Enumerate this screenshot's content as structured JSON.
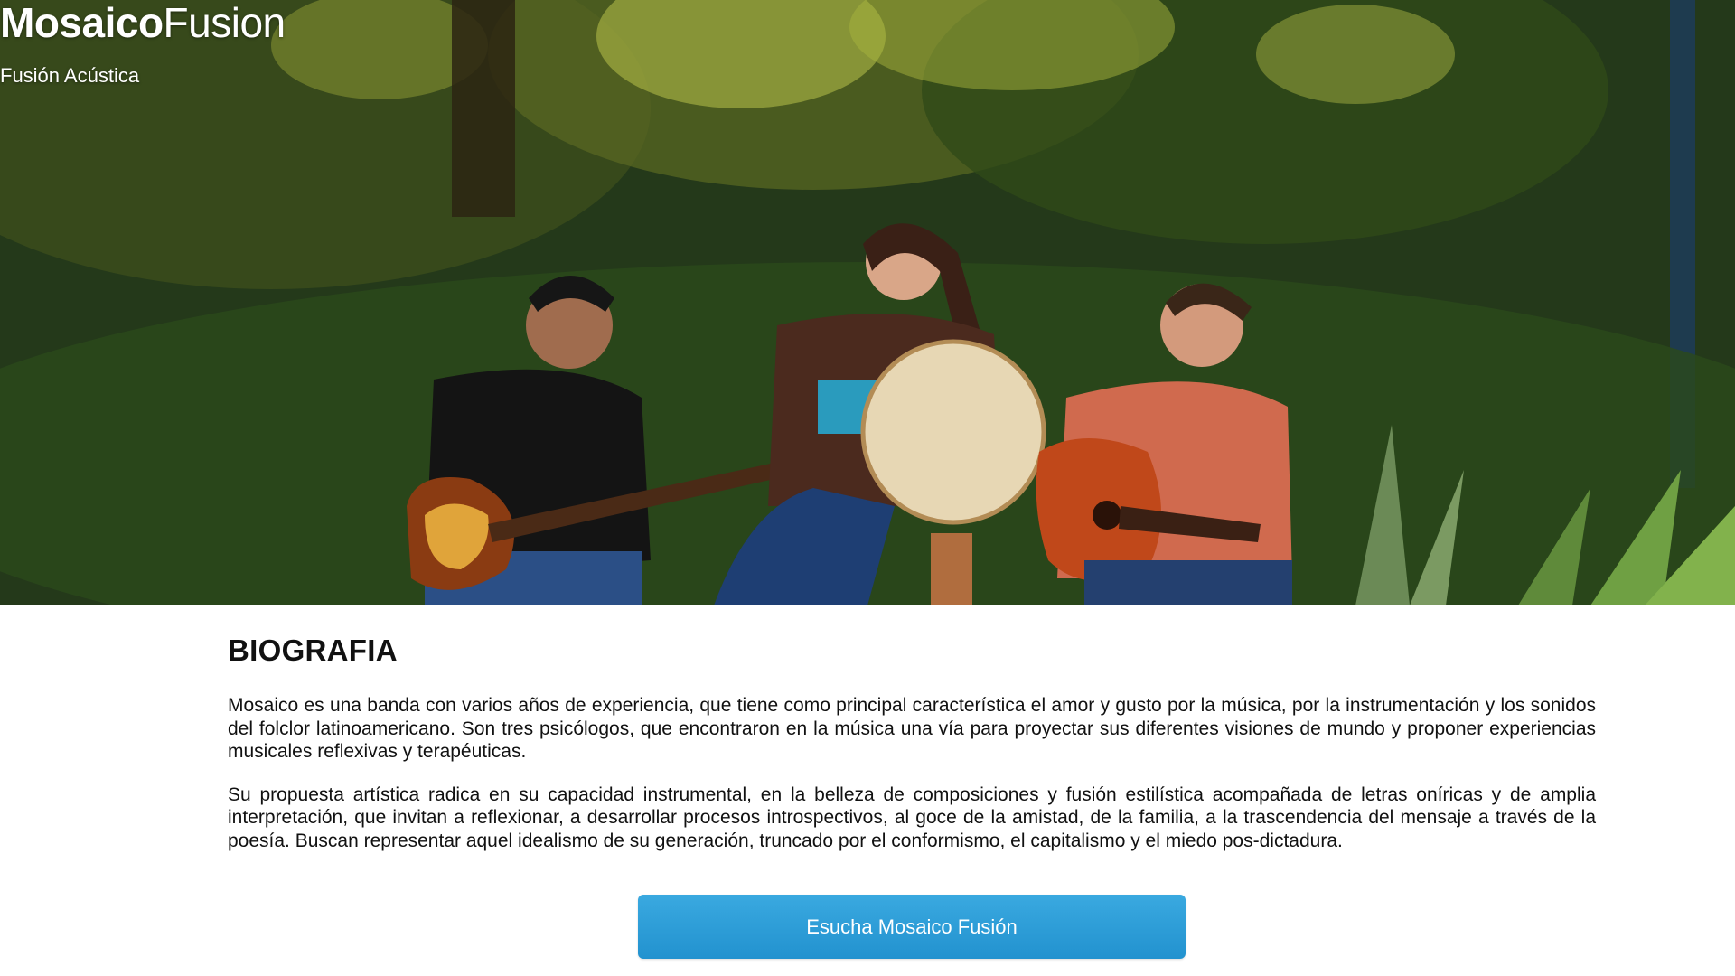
{
  "brand": {
    "title_bold": "Mosaico",
    "title_light": "Fusion",
    "tagline": "Fusión Acústica"
  },
  "hero": {
    "image_icon": "band-photo-icon"
  },
  "biography": {
    "heading": "BIOGRAFIA",
    "paragraphs": [
      "Mosaico es una banda con varios años de experiencia, que tiene como principal característica el amor y gusto por la música, por la instrumentación y los sonidos del folclor latinoamericano. Son tres psicólogos, que encontraron en la música una vía para proyectar sus diferentes visiones de mundo y proponer experiencias musicales reflexivas y terapéuticas.",
      "Su propuesta artística radica en su capacidad instrumental, en la belleza de composiciones y fusión estilística acompañada de letras oníricas y de amplia interpretación, que invitan a reflexionar, a desarrollar procesos introspectivos, al goce de la amistad, de la familia, a la trascendencia del mensaje a través de la poesía. Buscan representar aquel idealismo de su generación, truncado por el conformismo, el capitalismo y el miedo pos-dictadura."
    ]
  },
  "cta": {
    "label": "Esucha Mosaico Fusión"
  },
  "colors": {
    "accent": "#2a9ed8",
    "text": "#111111",
    "background": "#ffffff"
  }
}
